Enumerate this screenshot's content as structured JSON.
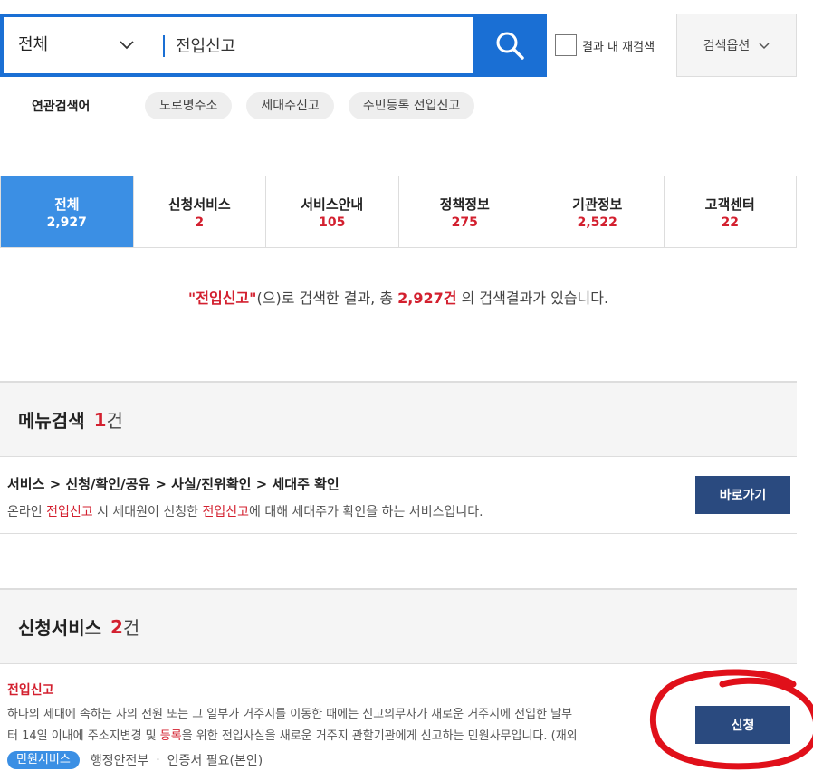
{
  "search": {
    "scope": "전체",
    "query": "전입신고",
    "re_search_label": "결과 내 재검색",
    "options_label": "검색옵션"
  },
  "related": {
    "label": "연관검색어",
    "keywords": [
      "도로명주소",
      "세대주신고",
      "주민등록 전입신고"
    ]
  },
  "tabs": [
    {
      "label": "전체",
      "count": "2,927"
    },
    {
      "label": "신청서비스",
      "count": "2"
    },
    {
      "label": "서비스안내",
      "count": "105"
    },
    {
      "label": "정책정보",
      "count": "275"
    },
    {
      "label": "기관정보",
      "count": "2,522"
    },
    {
      "label": "고객센터",
      "count": "22"
    }
  ],
  "summary": {
    "query_quoted": "\"전입신고\"",
    "text_mid": "(으)로 검색한 결과, 총 ",
    "total": "2,927건",
    "text_end": " 의 검색결과가 있습니다."
  },
  "menu_section": {
    "title": "메뉴검색",
    "count": "1",
    "unit": "건",
    "item": {
      "path": "서비스 > 신청/확인/공유 > 사실/진위확인 > 세대주 확인",
      "desc_1": "온라인 ",
      "desc_hl_1": "전입신고",
      "desc_2": " 시 세대원이 신청한 ",
      "desc_hl_2": "전입신고",
      "desc_3": "에 대해 세대주가 확인을 하는 서비스입니다.",
      "button": "바로가기"
    }
  },
  "apply_section": {
    "title": "신청서비스",
    "count": "2",
    "unit": "건",
    "item": {
      "title": "전입신고",
      "line1": "하나의 세대에 속하는 자의 전원 또는 그 일부가 거주지를 이동한 때에는 신고의무자가 새로운 거주지에 전입한 날부",
      "line2_a": "터 14일 이내에 주소지변경 및 ",
      "line2_hl": "등록",
      "line2_b": "을 위한 전입사실을 새로운 거주지 관할기관에게 신고하는 민원사무입니다. (재외",
      "tag": "민원서비스",
      "agency": "행정안전부",
      "sep": "·",
      "cert": "인증서 필요(본인)",
      "button": "신청"
    }
  },
  "colors": {
    "primary_blue": "#1a6fd4",
    "active_tab": "#3b8fe4",
    "highlight_red": "#d3202f",
    "navy_button": "#2a4a7f",
    "annotation_red": "#e0101a"
  }
}
